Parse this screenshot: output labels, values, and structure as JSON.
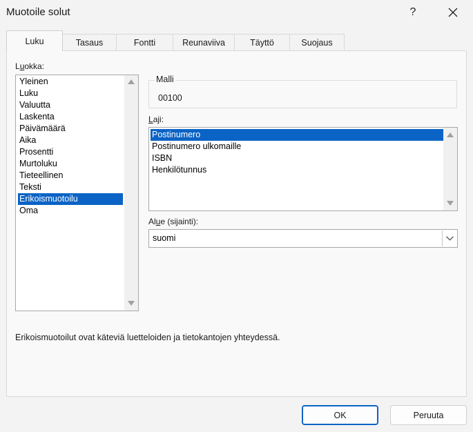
{
  "window": {
    "title": "Muotoile solut",
    "help_label": "?"
  },
  "tabs": [
    {
      "label": "Luku",
      "active": true
    },
    {
      "label": "Tasaus"
    },
    {
      "label": "Fontti"
    },
    {
      "label": "Reunaviiva"
    },
    {
      "label": "Täyttö"
    },
    {
      "label": "Suojaus"
    }
  ],
  "category": {
    "label_pre": "L",
    "label_u": "u",
    "label_post": "okka:",
    "items": [
      "Yleinen",
      "Luku",
      "Valuutta",
      "Laskenta",
      "Päivämäärä",
      "Aika",
      "Prosentti",
      "Murtoluku",
      "Tieteellinen",
      "Teksti",
      "Erikoismuotoilu",
      "Oma"
    ],
    "selected": "Erikoismuotoilu"
  },
  "sample": {
    "caption": "Malli",
    "value": "00100"
  },
  "type": {
    "label_u": "L",
    "label_post": "aji:",
    "items": [
      "Postinumero",
      "Postinumero ulkomaille",
      "ISBN",
      "Henkilötunnus"
    ],
    "selected": "Postinumero"
  },
  "locale": {
    "label_pre": "Al",
    "label_u": "u",
    "label_post": "e (sijainti):",
    "value": "suomi"
  },
  "description": "Erikoismuotoilut ovat käteviä luetteloiden ja tietokantojen yhteydessä.",
  "buttons": {
    "ok": "OK",
    "cancel": "Peruuta"
  },
  "colors": {
    "selection": "#0b63c5",
    "background": "#f3f3f3"
  }
}
